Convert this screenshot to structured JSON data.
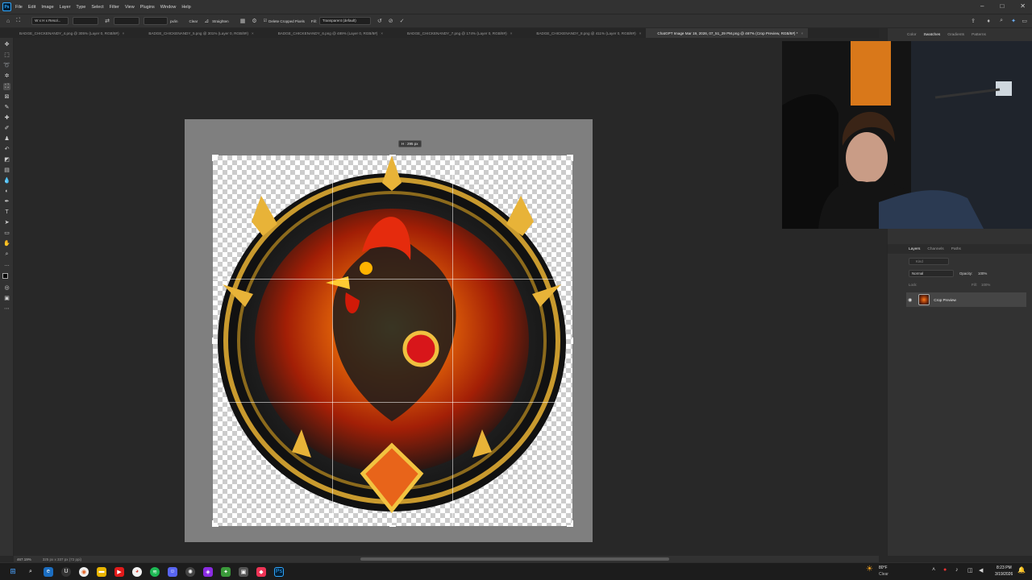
{
  "app": {
    "logo_text": "Ps"
  },
  "menu": [
    "File",
    "Edit",
    "Image",
    "Layer",
    "Type",
    "Select",
    "Filter",
    "View",
    "Plugins",
    "Window",
    "Help"
  ],
  "window_controls": [
    "–",
    "□",
    "✕"
  ],
  "options": {
    "ratio_select": "W x H x Resol...",
    "unit": "px/in",
    "clear_label": "Clear",
    "straighten_label": "Straighten",
    "delete_cropped_label": "Delete Cropped Pixels",
    "fill_label": "Fill:",
    "fill_value": "Transparent (default)"
  },
  "tabs": [
    {
      "label": "BADGE_CHICKENANDY_4.png @ 305% (Layer 0, RGB/8#)",
      "close": "×"
    },
    {
      "label": "BADGE_CHICKENANDY_5.png @ 301% (Layer 0, RGB/8#)",
      "close": "×"
    },
    {
      "label": "BADGE_CHICKENANDY_6.png @ 489% (Layer 0, RGB/8#)",
      "close": "×"
    },
    {
      "label": "BADGE_CHICKENANDY_7.png @ 174% (Layer 0, RGB/8#)",
      "close": "×"
    },
    {
      "label": "BADGE_CHICKENANDY_8.png @ 411% (Layer 0, RGB/8#)",
      "close": "×"
    },
    {
      "label": "ChatGPT Image Mar 19, 2026, 07_51_29 PM.png @ 467% (Crop Preview, RGB/8#) *",
      "close": "×"
    }
  ],
  "crop_tooltip": "H : 295 px",
  "top_panel_tabs": [
    "Color",
    "Swatches",
    "Gradients",
    "Patterns"
  ],
  "layers_panel": {
    "tabs": [
      "Layers",
      "Channels",
      "Paths"
    ],
    "kind_placeholder": "Kind",
    "blend_mode": "Normal",
    "opacity_label": "Opacity:",
    "opacity_value": "100%",
    "lock_label": "Lock:",
    "fill_label": "Fill:",
    "fill_value": "100%",
    "layer_name": "Crop Preview"
  },
  "status": {
    "zoom": "467.19%",
    "dimensions": "325 px x 337 px (72 ppi)"
  },
  "taskbar": {
    "weather_temp": "80°F",
    "weather_desc": "Clear",
    "time": "8:23 PM",
    "date": "3/19/2026"
  }
}
